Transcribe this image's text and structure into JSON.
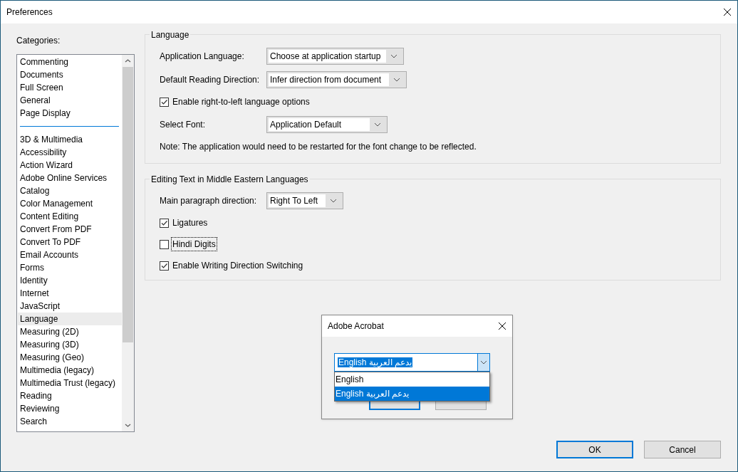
{
  "window": {
    "title": "Preferences"
  },
  "categories": {
    "label": "Categories:",
    "groups": [
      [
        {
          "label": "Commenting",
          "selected": false
        },
        {
          "label": "Documents",
          "selected": false
        },
        {
          "label": "Full Screen",
          "selected": false
        },
        {
          "label": "General",
          "selected": false
        },
        {
          "label": "Page Display",
          "selected": false
        }
      ],
      [
        {
          "label": "3D & Multimedia",
          "selected": false
        },
        {
          "label": "Accessibility",
          "selected": false
        },
        {
          "label": "Action Wizard",
          "selected": false
        },
        {
          "label": "Adobe Online Services",
          "selected": false
        },
        {
          "label": "Catalog",
          "selected": false
        },
        {
          "label": "Color Management",
          "selected": false
        },
        {
          "label": "Content Editing",
          "selected": false
        },
        {
          "label": "Convert From PDF",
          "selected": false
        },
        {
          "label": "Convert To PDF",
          "selected": false
        },
        {
          "label": "Email Accounts",
          "selected": false
        },
        {
          "label": "Forms",
          "selected": false
        },
        {
          "label": "Identity",
          "selected": false
        },
        {
          "label": "Internet",
          "selected": false
        },
        {
          "label": "JavaScript",
          "selected": false
        },
        {
          "label": "Language",
          "selected": true
        },
        {
          "label": "Measuring (2D)",
          "selected": false
        },
        {
          "label": "Measuring (3D)",
          "selected": false
        },
        {
          "label": "Measuring (Geo)",
          "selected": false
        },
        {
          "label": "Multimedia (legacy)",
          "selected": false
        },
        {
          "label": "Multimedia Trust (legacy)",
          "selected": false
        },
        {
          "label": "Reading",
          "selected": false
        },
        {
          "label": "Reviewing",
          "selected": false
        },
        {
          "label": "Search",
          "selected": false
        }
      ]
    ]
  },
  "sections": [
    {
      "title": "Language",
      "fields": [
        {
          "kind": "select",
          "label": "Application Language:",
          "value": "Choose at application startup"
        },
        {
          "kind": "select",
          "label": "Default Reading Direction:",
          "value": "Infer direction from document"
        },
        {
          "kind": "checkbox",
          "label": "Enable right-to-left language options",
          "checked": true,
          "focused": false
        },
        {
          "kind": "select",
          "label": "Select Font:",
          "value": "Application Default"
        },
        {
          "kind": "note",
          "text": "Note: The application would need to be restarted for the font change to be reflected."
        }
      ]
    },
    {
      "title": "Editing Text in Middle Eastern Languages",
      "fields": [
        {
          "kind": "select",
          "label": "Main paragraph direction:",
          "value": "Right To Left"
        },
        {
          "kind": "checkbox",
          "label": "Ligatures",
          "checked": true,
          "focused": false
        },
        {
          "kind": "checkbox",
          "label": "Hindi Digits",
          "checked": false,
          "focused": true
        },
        {
          "kind": "checkbox",
          "label": "Enable Writing Direction Switching",
          "checked": true,
          "focused": false
        }
      ]
    }
  ],
  "dialog": {
    "title": "Adobe Acrobat",
    "combo": {
      "value": "English يدعم العربية"
    },
    "options": [
      {
        "label": "English",
        "selected": false
      },
      {
        "label": "English يدعم العربية",
        "selected": true
      }
    ],
    "buttons": [
      {
        "default": true
      },
      {
        "default": false
      }
    ]
  },
  "buttons": [
    {
      "label": "OK",
      "default": true
    },
    {
      "label": "Cancel",
      "default": false
    }
  ]
}
